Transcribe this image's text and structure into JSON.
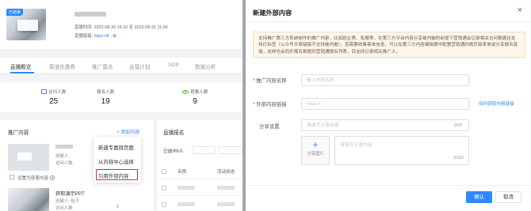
{
  "live": {
    "badge": "已结束",
    "time_label": "直播时间:",
    "time_value": "2022-08-30 16:10 至 2022-08-31 11:00",
    "link_label": "直播链接:",
    "link_value": "https://fr"
  },
  "tabs": [
    {
      "label": "直播概览"
    },
    {
      "label": "渠道优惠券"
    },
    {
      "label": "推广雷达"
    },
    {
      "label": "运营计划"
    },
    {
      "label": "SOP"
    },
    {
      "label": "数据分析"
    }
  ],
  "stats": [
    {
      "label": "访问人数",
      "value": "25"
    },
    {
      "label": "报名人数",
      "value": "19"
    },
    {
      "label": "观看人数",
      "value": "9"
    }
  ],
  "promo": {
    "title": "推广内容",
    "add_label": "+ 添加内容",
    "card1": {
      "creator": "创建人:",
      "visitors": "访问人数:"
    },
    "set_lead_magnet": "设置为获客内容",
    "card2": {
      "title": "获取演示PPT",
      "creator": "创建人: 包子",
      "uv": "访问人数:",
      "count": "0"
    }
  },
  "dropdown": {
    "items": [
      "新建专属微页面",
      "从内容中心选择",
      "引用外部内容"
    ]
  },
  "signup": {
    "title": "直播报名",
    "selected": "已选中0人",
    "col_name": "名称",
    "col_status": "活动状态"
  },
  "modal": {
    "title": "新建外部内容",
    "close": "×",
    "tip": "支持推广第三方系统制作的推广内容，比如励企秀、免展等，在第三方平台内容分享被内嵌的前提下营销通会记录相关访问数据且支持打标签（公众号文章链接不支持被内嵌），若需要收集客单信息，可以在第三方内容编辑器中配置营销通的微页面表单或分享报名链接，这样也会同步报名数据到营销通报名列表，目支持记录相关推广人。",
    "name_label": "推广内容名称",
    "name_placeholder": "输入内容名称",
    "link_label": "外部内容链接",
    "link_placeholder": "https://",
    "link_action": "如何获取内容链接",
    "share_label": "分享设置",
    "share_placeholder": "请填写分享标题",
    "share_count": "0/20",
    "upload_label": "分享图片",
    "desc_placeholder": "请填写分享内容",
    "desc_count": "0/100",
    "ok": "确认",
    "cancel": "取消"
  },
  "colors": {
    "accent": "#2f88ff",
    "warning_bg": "#fdf6ec",
    "highlight": "#e0302b"
  }
}
